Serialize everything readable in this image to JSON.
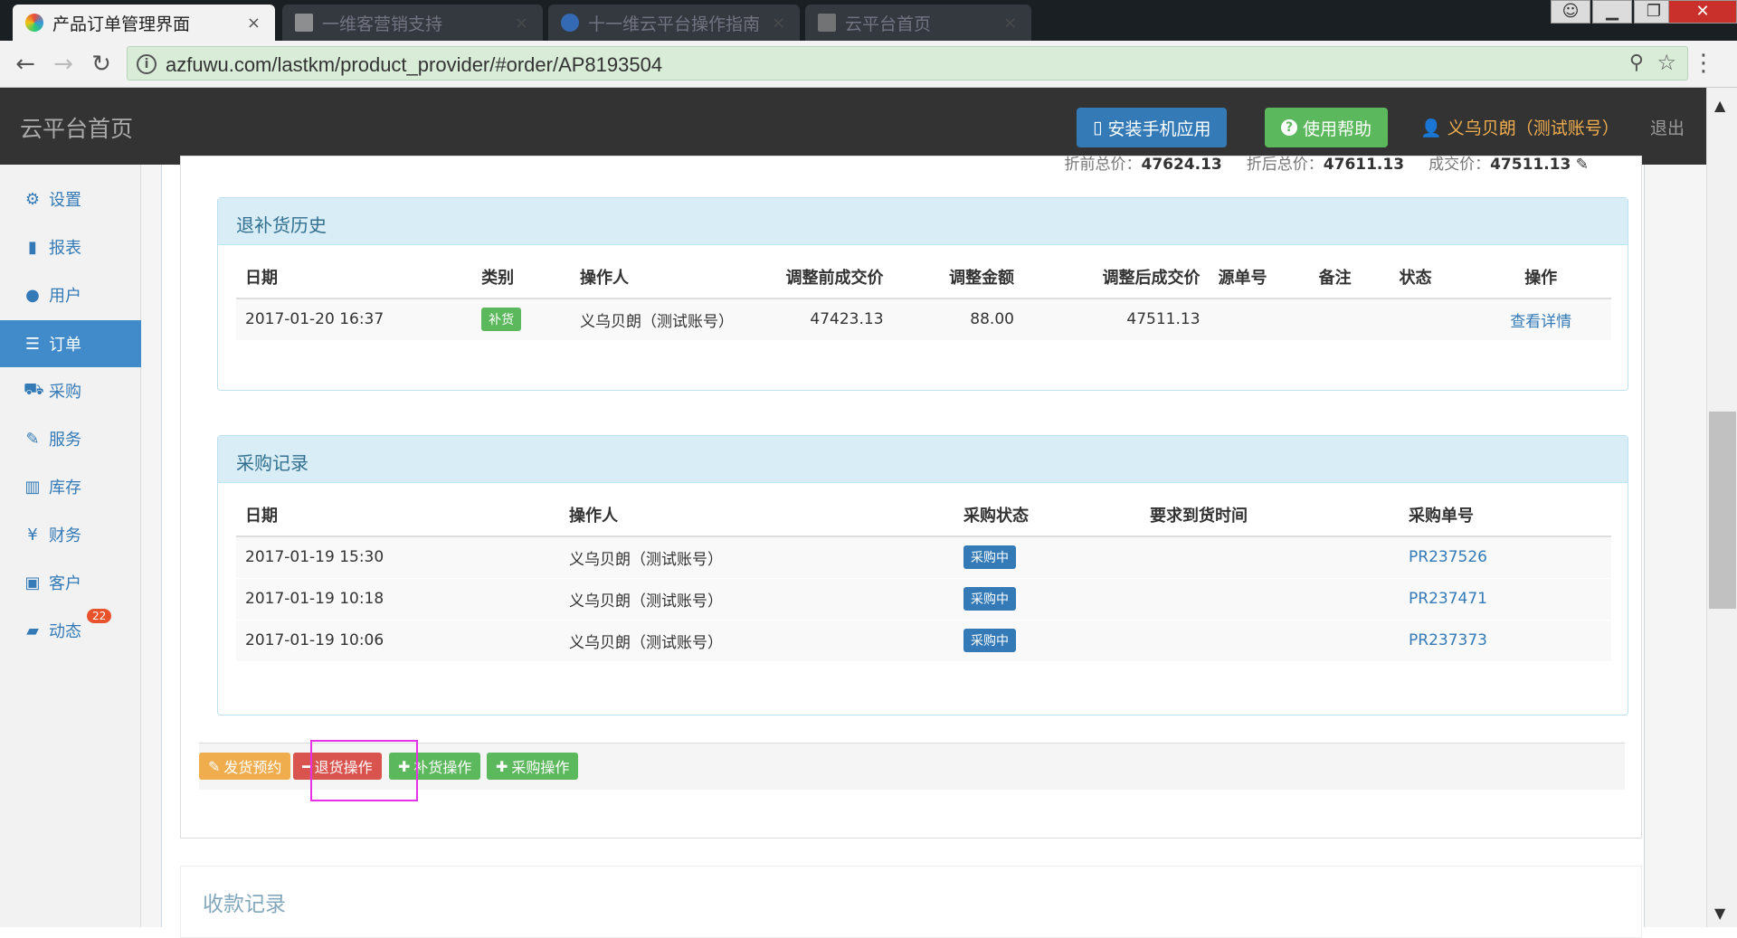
{
  "browser": {
    "tabs": [
      {
        "title": "产品订单管理界面",
        "active": true
      },
      {
        "title": "一维客营销支持",
        "active": false
      },
      {
        "title": "十一维云平台操作指南",
        "active": false
      },
      {
        "title": "云平台首页",
        "active": false
      }
    ],
    "url": "azfuwu.com/lastkm/product_provider/#order/AP8193504",
    "close_glyph": "×",
    "window_controls": {
      "min": "▁",
      "max": "❐",
      "close": "✕"
    }
  },
  "topbar": {
    "brand": "云平台首页",
    "install_app": "安装手机应用",
    "help": "使用帮助",
    "user": "义乌贝朗（测试账号）",
    "logout": "退出"
  },
  "sidebar": {
    "items": [
      {
        "label": "设置",
        "icon": "gear-icon"
      },
      {
        "label": "报表",
        "icon": "bar-chart-icon"
      },
      {
        "label": "用户",
        "icon": "user-icon"
      },
      {
        "label": "订单",
        "icon": "list-icon",
        "active": true
      },
      {
        "label": "采购",
        "icon": "cart-icon"
      },
      {
        "label": "服务",
        "icon": "wrench-icon"
      },
      {
        "label": "库存",
        "icon": "barcode-icon"
      },
      {
        "label": "财务",
        "icon": "yen-icon"
      },
      {
        "label": "客户",
        "icon": "briefcase-icon"
      },
      {
        "label": "动态",
        "icon": "comment-icon",
        "badge": "22"
      }
    ]
  },
  "totals": {
    "pre_label": "折前总价：",
    "pre_value": "47624.13",
    "post_label": "折后总价：",
    "post_value": "47611.13",
    "deal_label": "成交价：",
    "deal_value": "47511.13"
  },
  "return_history": {
    "title": "退补货历史",
    "columns": [
      "日期",
      "类别",
      "操作人",
      "调整前成交价",
      "调整金额",
      "调整后成交价",
      "源单号",
      "备注",
      "状态",
      "操作"
    ],
    "rows": [
      {
        "date": "2017-01-20 16:37",
        "type": "补货",
        "operator": "义乌贝朗（测试账号）",
        "before": "47423.13",
        "amount": "88.00",
        "after": "47511.13",
        "source": "",
        "note": "",
        "status": "",
        "action": "查看详情"
      }
    ]
  },
  "purchase_records": {
    "title": "采购记录",
    "columns": [
      "日期",
      "操作人",
      "采购状态",
      "要求到货时间",
      "采购单号"
    ],
    "rows": [
      {
        "date": "2017-01-19 15:30",
        "operator": "义乌贝朗（测试账号）",
        "status": "采购中",
        "due": "",
        "po": "PR237526"
      },
      {
        "date": "2017-01-19 10:18",
        "operator": "义乌贝朗（测试账号）",
        "status": "采购中",
        "due": "",
        "po": "PR237471"
      },
      {
        "date": "2017-01-19 10:06",
        "operator": "义乌贝朗（测试账号）",
        "status": "采购中",
        "due": "",
        "po": "PR237373"
      }
    ]
  },
  "actions": {
    "ship": "发货预约",
    "return": "退货操作",
    "replenish": "补货操作",
    "purchase": "采购操作"
  },
  "receipt": {
    "title": "收款记录"
  },
  "colors": {
    "primary": "#337ab7",
    "success": "#5cb85c",
    "warning": "#f0ad4e",
    "danger": "#d9534f",
    "highlight": "#e830e8"
  }
}
